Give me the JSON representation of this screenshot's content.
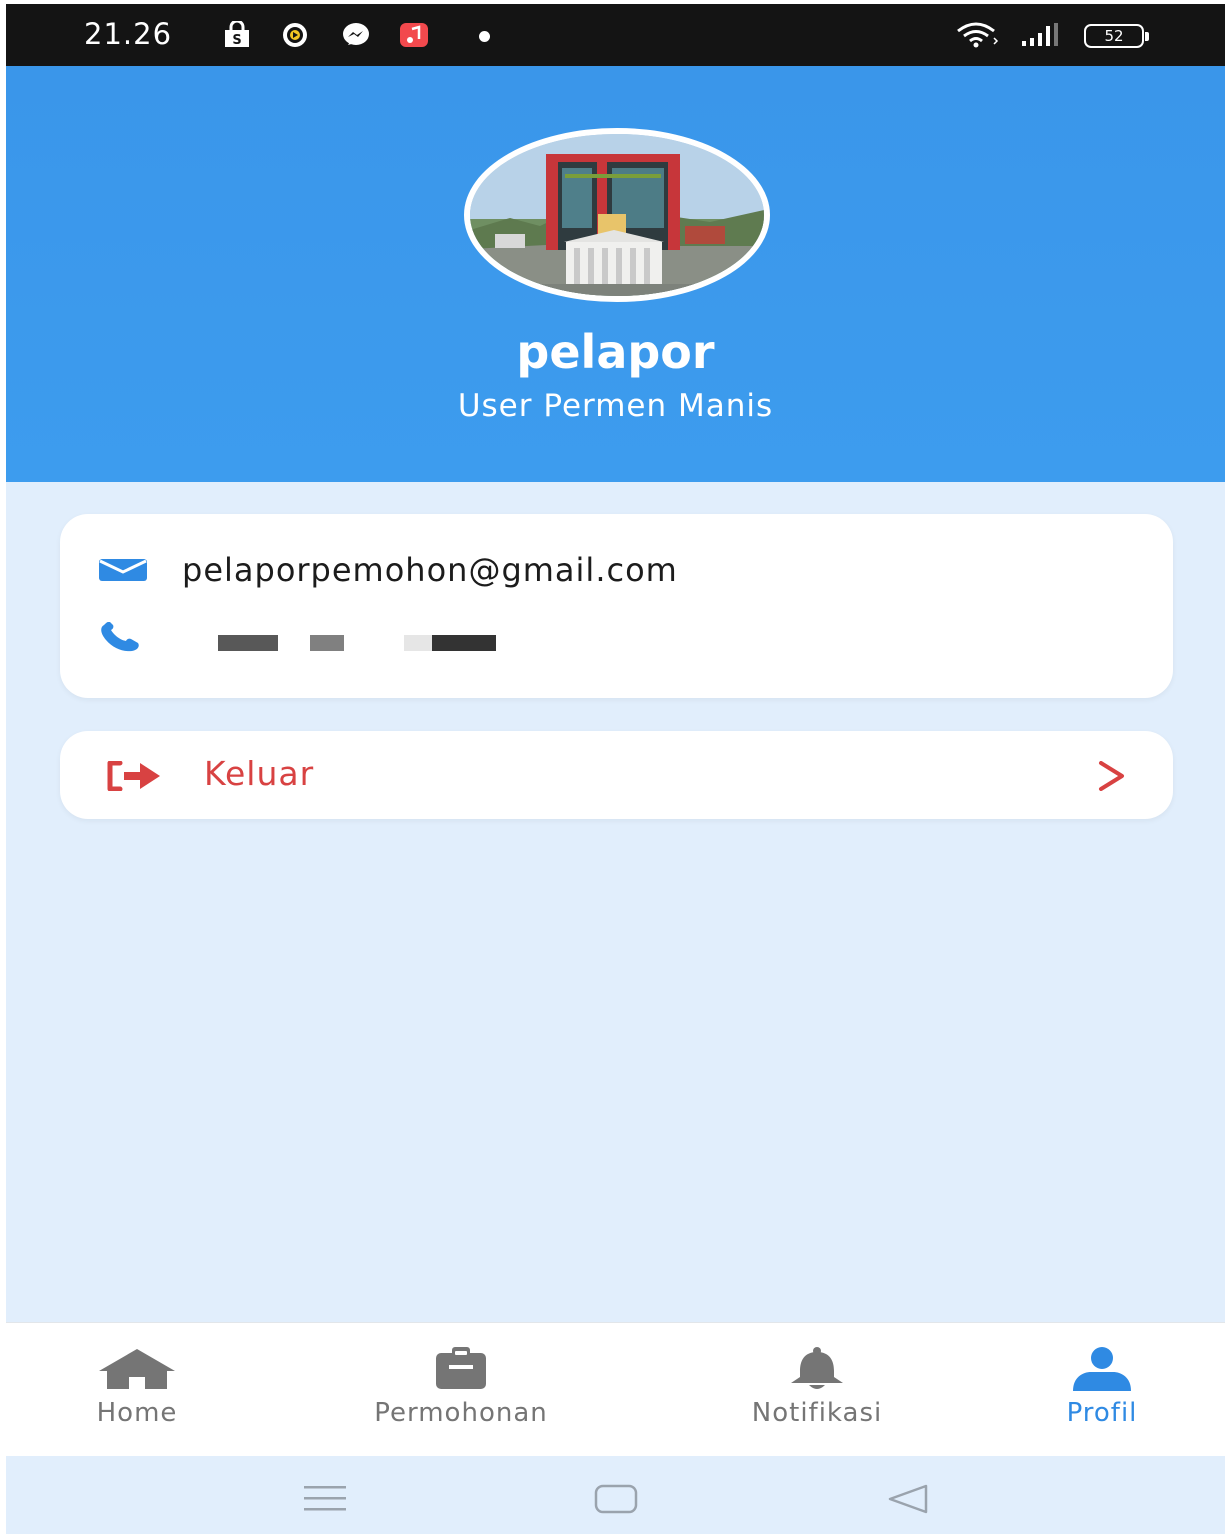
{
  "status_bar": {
    "time": "21.26",
    "battery": "52"
  },
  "profile": {
    "name": "pelapor",
    "role": "User Permen Manis"
  },
  "contact": {
    "email": "pelaporpemohon@gmail.com"
  },
  "logout": {
    "label": "Keluar"
  },
  "bottom_nav": {
    "items": [
      {
        "label": "Home",
        "icon": "home-icon"
      },
      {
        "label": "Permohonan",
        "icon": "clipboard-icon"
      },
      {
        "label": "Notifikasi",
        "icon": "bell-icon"
      },
      {
        "label": "Profil",
        "icon": "user-icon"
      }
    ],
    "active": "Profil"
  },
  "colors": {
    "header": "#3a96ea",
    "background": "#e1eefc",
    "accent": "#2f8ae3",
    "logout": "#d84242",
    "inactive": "#757575"
  }
}
